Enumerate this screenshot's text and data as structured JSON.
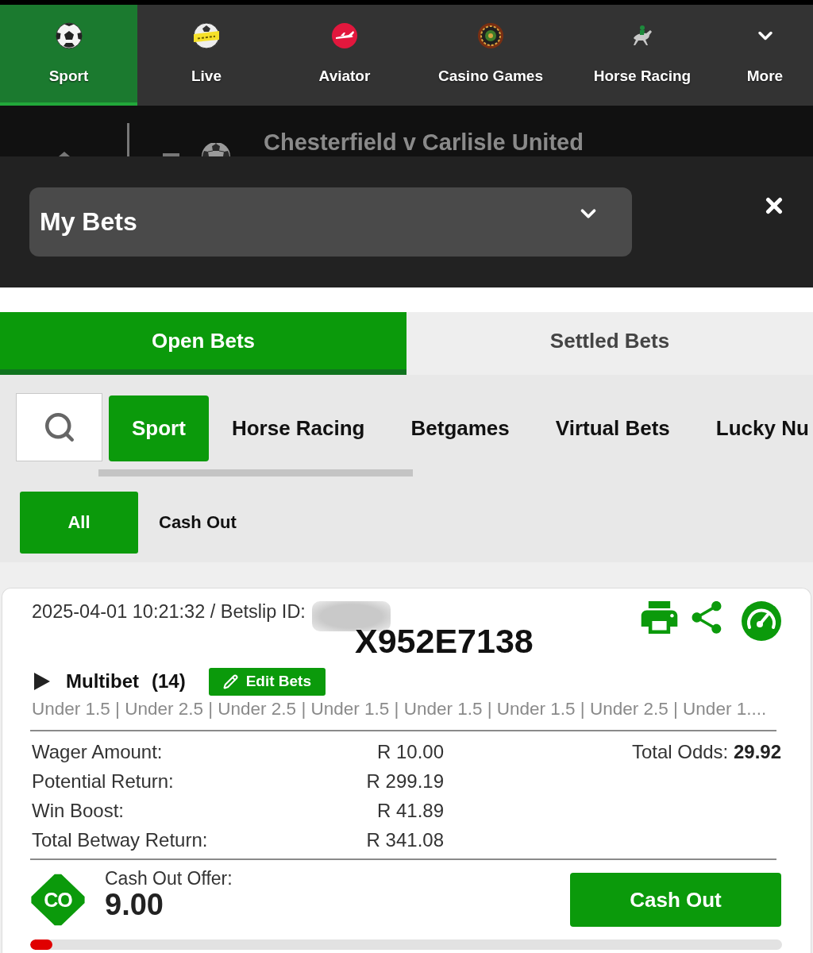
{
  "top_nav": {
    "items": [
      {
        "label": "Sport",
        "kind": "ball",
        "selected": true
      },
      {
        "label": "Live",
        "kind": "live",
        "selected": false
      },
      {
        "label": "Aviator",
        "kind": "aviator",
        "selected": false
      },
      {
        "label": "Casino Games",
        "kind": "casino",
        "selected": false
      },
      {
        "label": "Horse Racing",
        "kind": "horse",
        "selected": false
      },
      {
        "label": "More",
        "kind": "chevron",
        "selected": false
      }
    ]
  },
  "match_banner": {
    "title": "Chesterfield v Carlisle United"
  },
  "bets_panel": {
    "dropdown": {
      "value": "My Bets"
    }
  },
  "bet_tabs": [
    {
      "label": "Open Bets",
      "selected": true
    },
    {
      "label": "Settled Bets",
      "selected": false
    }
  ],
  "category_tabs": [
    {
      "label": "Sport",
      "selected": true
    },
    {
      "label": "Horse Racing",
      "selected": false
    },
    {
      "label": "Betgames",
      "selected": false
    },
    {
      "label": "Virtual Bets",
      "selected": false
    },
    {
      "label": "Lucky Nu",
      "selected": false
    }
  ],
  "filter_tabs": [
    {
      "label": "All",
      "selected": true
    },
    {
      "label": "Cash Out",
      "selected": false
    }
  ],
  "bet_card": {
    "header": "2025-04-01 10:21:32 / Betslip ID:",
    "betslip_id_overlay": "X952E7138",
    "bet_type": "Multibet",
    "count": "(14)",
    "edit_button": "Edit Bets",
    "selections": "Under 1.5 | Under 2.5 | Under 2.5 | Under 1.5 | Under 1.5 | Under 1.5 | Under 2.5 | Under 1....",
    "summary": [
      {
        "label": "Wager Amount:",
        "value": "R 10.00"
      },
      {
        "label": "Potential Return:",
        "value": "R 299.19"
      },
      {
        "label": "Win Boost:",
        "value": "R 41.89"
      },
      {
        "label": "Total Betway Return:",
        "value": "R 341.08"
      }
    ],
    "total_odds": "Total Odds: **29.92**",
    "cash_out": {
      "badge": "CO",
      "label": "Cash Out Offer:",
      "amount": "9.00",
      "button": "Cash Out",
      "progress": {
        "level": 0.03
      }
    }
  }
}
